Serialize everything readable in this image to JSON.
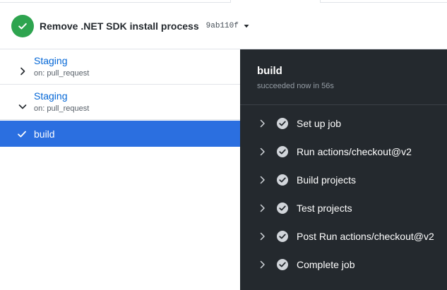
{
  "run": {
    "title": "Remove .NET SDK install process",
    "sha": "9ab110f",
    "status": "success"
  },
  "sidebar": {
    "workflows": [
      {
        "name": "Staging",
        "event": "on: pull_request",
        "expanded": false
      },
      {
        "name": "Staging",
        "event": "on: pull_request",
        "expanded": true
      }
    ],
    "active_job": {
      "name": "build"
    }
  },
  "job_panel": {
    "title": "build",
    "subtitle": "succeeded now in 56s",
    "steps": [
      {
        "name": "Set up job"
      },
      {
        "name": "Run actions/checkout@v2"
      },
      {
        "name": "Build projects"
      },
      {
        "name": "Test projects"
      },
      {
        "name": "Post Run actions/checkout@v2"
      },
      {
        "name": "Complete job"
      }
    ]
  },
  "colors": {
    "success_green": "#2ea44f",
    "link_blue": "#0366d6",
    "selected_blue": "#2b6fe0",
    "panel_bg": "#24292e"
  }
}
